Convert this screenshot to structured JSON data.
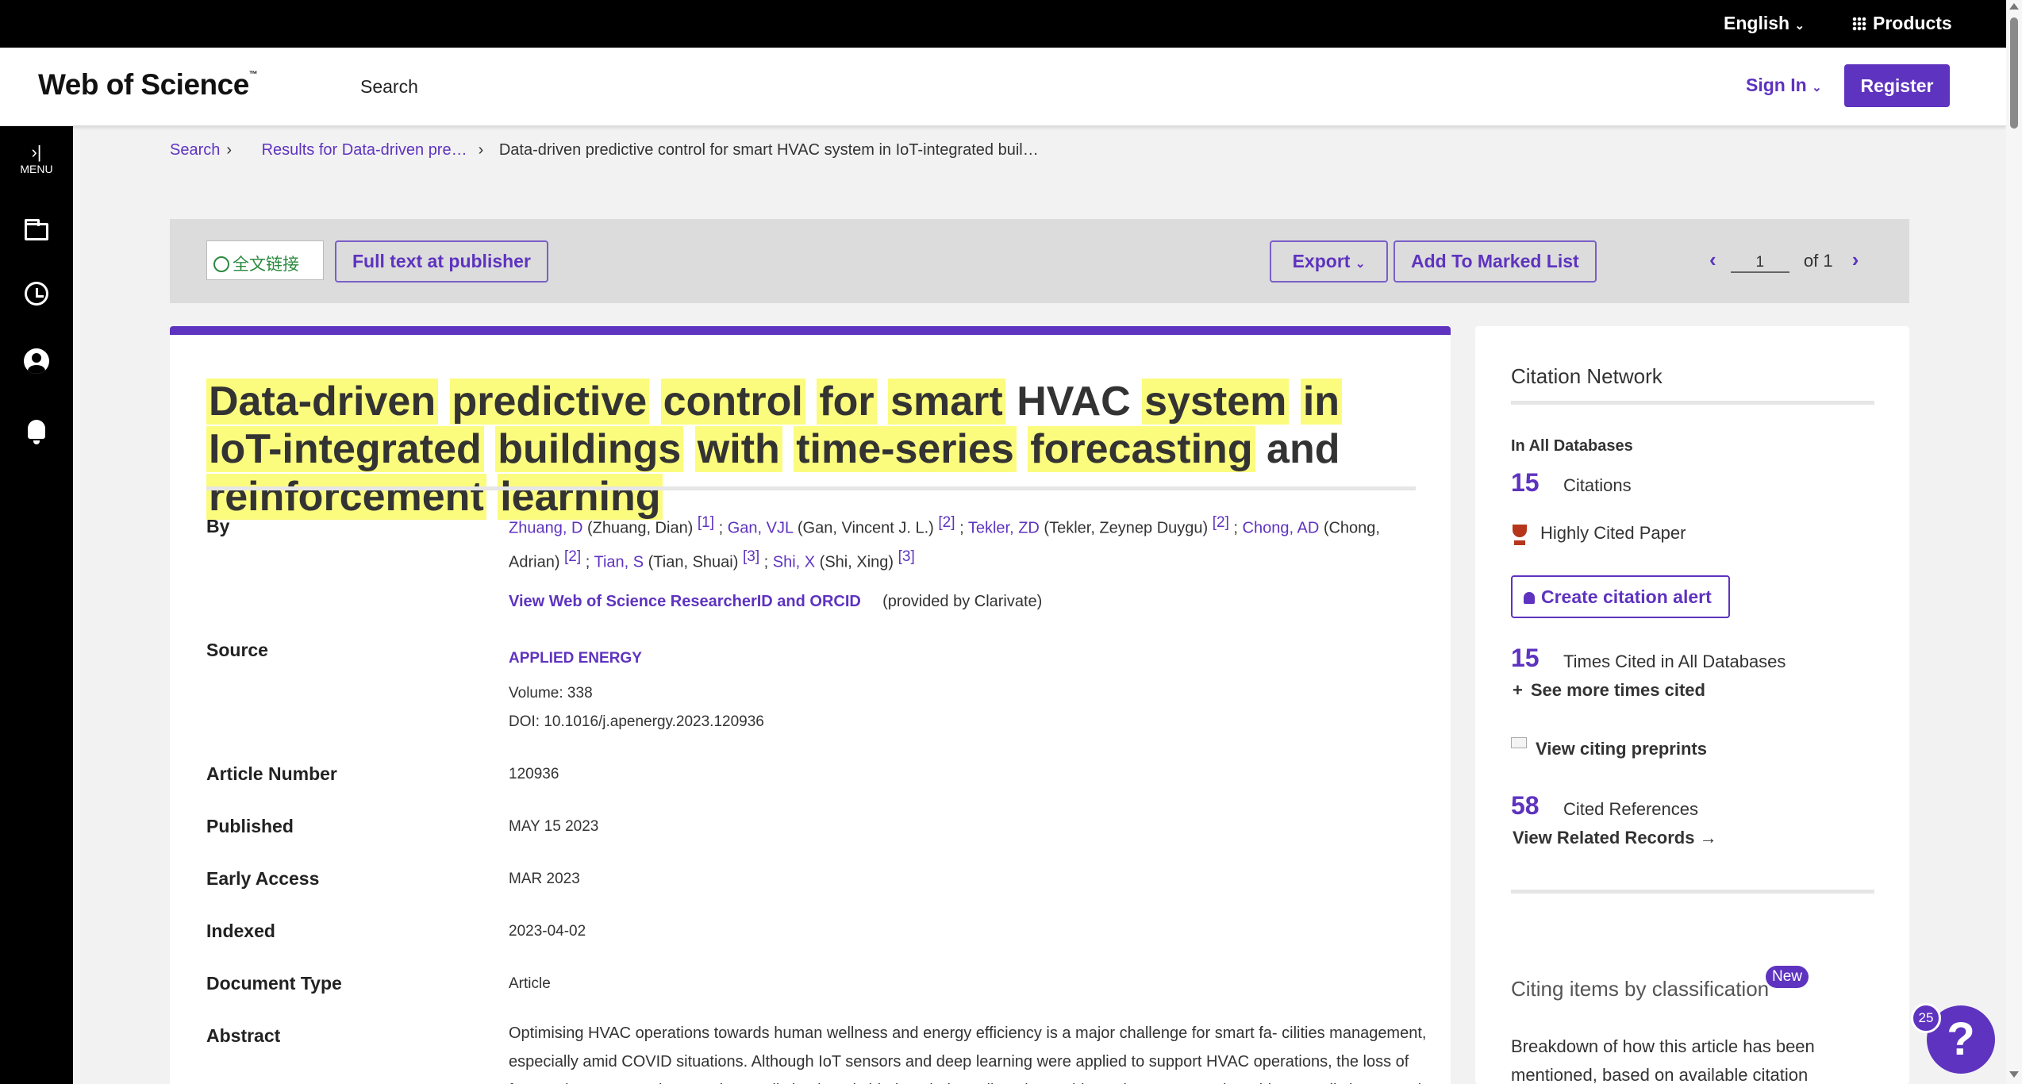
{
  "topbar": {
    "language": "English",
    "products": "Products"
  },
  "header": {
    "logo": "Web of Science",
    "logo_tm": "™",
    "nav_search": "Search",
    "sign_in": "Sign In",
    "register": "Register"
  },
  "sidebar": {
    "menu": "MENU"
  },
  "breadcrumb": {
    "search": "Search",
    "results": "Results for Data-driven pre…",
    "current": "Data-driven predictive control for smart HVAC system in IoT-integrated buil…"
  },
  "toolbar": {
    "fulltext_logo": "全文链接",
    "full_text": "Full text at publisher",
    "export": "Export",
    "marked_list": "Add To Marked List",
    "page": "1",
    "of": "of 1"
  },
  "record": {
    "title_words": [
      {
        "w": "Data-driven",
        "hl": true
      },
      {
        "w": "predictive",
        "hl": true
      },
      {
        "w": "control",
        "hl": true
      },
      {
        "w": "for",
        "hl": true
      },
      {
        "w": "smart",
        "hl": true
      },
      {
        "w": "HVAC",
        "hl": false
      },
      {
        "w": "system",
        "hl": true
      },
      {
        "w": "in",
        "hl": true
      },
      {
        "w": "IoT-integrated",
        "hl": true
      },
      {
        "w": "buildings",
        "hl": true
      },
      {
        "w": "with",
        "hl": true
      },
      {
        "w": "time-series",
        "hl": true
      },
      {
        "w": "forecasting",
        "hl": true
      },
      {
        "w": "and",
        "hl": false
      },
      {
        "w": "reinforcement",
        "hl": true
      },
      {
        "w": "learning",
        "hl": true
      }
    ],
    "labels": {
      "by": "By",
      "source": "Source",
      "article_number": "Article Number",
      "published": "Published",
      "early_access": "Early Access",
      "indexed": "Indexed",
      "document_type": "Document Type",
      "abstract": "Abstract"
    },
    "authors": [
      {
        "short": "Zhuang, D",
        "full": "(Zhuang, Dian)",
        "aff": "[1]"
      },
      {
        "short": "Gan, VJL",
        "full": "(Gan, Vincent J. L.)",
        "aff": "[2]"
      },
      {
        "short": "Tekler, ZD",
        "full": "(Tekler, Zeynep Duygu)",
        "aff": "[2]"
      },
      {
        "short": "Chong, AD",
        "full": "(Chong, Adrian)",
        "aff": "[2]"
      },
      {
        "short": "Tian, S",
        "full": "(Tian, Shuai)",
        "aff": "[3]"
      },
      {
        "short": "Shi, X",
        "full": "(Shi, Xing)",
        "aff": "[3]"
      }
    ],
    "researcher_link": "View Web of Science ResearcherID and ORCID",
    "provided_by": "(provided by Clarivate)",
    "source_journal": "APPLIED ENERGY",
    "volume": "Volume: 338",
    "doi": "DOI: 10.1016/j.apenergy.2023.120936",
    "article_number": "120936",
    "published": "MAY 15 2023",
    "early_access": "MAR 2023",
    "indexed": "2023-04-02",
    "document_type": "Article",
    "abstract_line1": "Optimising HVAC operations towards human wellness and energy efficiency is a major challenge for smart fa- cilities management,",
    "abstract_line2": "especially amid COVID situations. Although IoT sensors and deep learning were applied to support HVAC operations, the loss of",
    "abstract_line3": "forecasting accuracy in recursive prediction largely hinders their appli- cations. This study presents a data-driven predictive control"
  },
  "citation_network": {
    "title": "Citation Network",
    "in_all_db": "In All Databases",
    "citations_count": "15",
    "citations_label": "Citations",
    "highly_cited": "Highly Cited Paper",
    "create_alert": "Create citation alert",
    "times_cited_count": "15",
    "times_cited_label": "Times Cited in All Databases",
    "see_more": "See more times cited",
    "citing_preprints": "View citing preprints",
    "cited_refs_count": "58",
    "cited_refs_label": "Cited References",
    "related_records": "View Related Records",
    "classification": "Citing items by classification",
    "new_badge": "New",
    "breakdown_line1": "Breakdown of how this article has been",
    "breakdown_line2": "mentioned, based on available citation"
  },
  "help": {
    "count": "25",
    "symbol": "?"
  },
  "colors": {
    "accent": "#5e33bf",
    "highlight": "#fbfb7e",
    "topbar": "#000000"
  }
}
